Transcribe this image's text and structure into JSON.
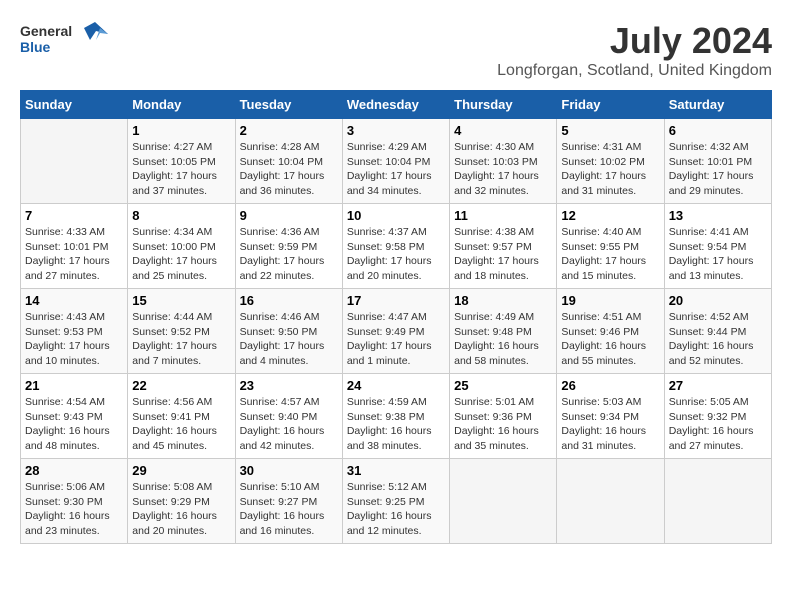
{
  "header": {
    "logo_general": "General",
    "logo_blue": "Blue",
    "month_year": "July 2024",
    "location": "Longforgan, Scotland, United Kingdom"
  },
  "days_of_week": [
    "Sunday",
    "Monday",
    "Tuesday",
    "Wednesday",
    "Thursday",
    "Friday",
    "Saturday"
  ],
  "weeks": [
    [
      {
        "num": "",
        "info": ""
      },
      {
        "num": "1",
        "info": "Sunrise: 4:27 AM\nSunset: 10:05 PM\nDaylight: 17 hours\nand 37 minutes."
      },
      {
        "num": "2",
        "info": "Sunrise: 4:28 AM\nSunset: 10:04 PM\nDaylight: 17 hours\nand 36 minutes."
      },
      {
        "num": "3",
        "info": "Sunrise: 4:29 AM\nSunset: 10:04 PM\nDaylight: 17 hours\nand 34 minutes."
      },
      {
        "num": "4",
        "info": "Sunrise: 4:30 AM\nSunset: 10:03 PM\nDaylight: 17 hours\nand 32 minutes."
      },
      {
        "num": "5",
        "info": "Sunrise: 4:31 AM\nSunset: 10:02 PM\nDaylight: 17 hours\nand 31 minutes."
      },
      {
        "num": "6",
        "info": "Sunrise: 4:32 AM\nSunset: 10:01 PM\nDaylight: 17 hours\nand 29 minutes."
      }
    ],
    [
      {
        "num": "7",
        "info": "Sunrise: 4:33 AM\nSunset: 10:01 PM\nDaylight: 17 hours\nand 27 minutes."
      },
      {
        "num": "8",
        "info": "Sunrise: 4:34 AM\nSunset: 10:00 PM\nDaylight: 17 hours\nand 25 minutes."
      },
      {
        "num": "9",
        "info": "Sunrise: 4:36 AM\nSunset: 9:59 PM\nDaylight: 17 hours\nand 22 minutes."
      },
      {
        "num": "10",
        "info": "Sunrise: 4:37 AM\nSunset: 9:58 PM\nDaylight: 17 hours\nand 20 minutes."
      },
      {
        "num": "11",
        "info": "Sunrise: 4:38 AM\nSunset: 9:57 PM\nDaylight: 17 hours\nand 18 minutes."
      },
      {
        "num": "12",
        "info": "Sunrise: 4:40 AM\nSunset: 9:55 PM\nDaylight: 17 hours\nand 15 minutes."
      },
      {
        "num": "13",
        "info": "Sunrise: 4:41 AM\nSunset: 9:54 PM\nDaylight: 17 hours\nand 13 minutes."
      }
    ],
    [
      {
        "num": "14",
        "info": "Sunrise: 4:43 AM\nSunset: 9:53 PM\nDaylight: 17 hours\nand 10 minutes."
      },
      {
        "num": "15",
        "info": "Sunrise: 4:44 AM\nSunset: 9:52 PM\nDaylight: 17 hours\nand 7 minutes."
      },
      {
        "num": "16",
        "info": "Sunrise: 4:46 AM\nSunset: 9:50 PM\nDaylight: 17 hours\nand 4 minutes."
      },
      {
        "num": "17",
        "info": "Sunrise: 4:47 AM\nSunset: 9:49 PM\nDaylight: 17 hours\nand 1 minute."
      },
      {
        "num": "18",
        "info": "Sunrise: 4:49 AM\nSunset: 9:48 PM\nDaylight: 16 hours\nand 58 minutes."
      },
      {
        "num": "19",
        "info": "Sunrise: 4:51 AM\nSunset: 9:46 PM\nDaylight: 16 hours\nand 55 minutes."
      },
      {
        "num": "20",
        "info": "Sunrise: 4:52 AM\nSunset: 9:44 PM\nDaylight: 16 hours\nand 52 minutes."
      }
    ],
    [
      {
        "num": "21",
        "info": "Sunrise: 4:54 AM\nSunset: 9:43 PM\nDaylight: 16 hours\nand 48 minutes."
      },
      {
        "num": "22",
        "info": "Sunrise: 4:56 AM\nSunset: 9:41 PM\nDaylight: 16 hours\nand 45 minutes."
      },
      {
        "num": "23",
        "info": "Sunrise: 4:57 AM\nSunset: 9:40 PM\nDaylight: 16 hours\nand 42 minutes."
      },
      {
        "num": "24",
        "info": "Sunrise: 4:59 AM\nSunset: 9:38 PM\nDaylight: 16 hours\nand 38 minutes."
      },
      {
        "num": "25",
        "info": "Sunrise: 5:01 AM\nSunset: 9:36 PM\nDaylight: 16 hours\nand 35 minutes."
      },
      {
        "num": "26",
        "info": "Sunrise: 5:03 AM\nSunset: 9:34 PM\nDaylight: 16 hours\nand 31 minutes."
      },
      {
        "num": "27",
        "info": "Sunrise: 5:05 AM\nSunset: 9:32 PM\nDaylight: 16 hours\nand 27 minutes."
      }
    ],
    [
      {
        "num": "28",
        "info": "Sunrise: 5:06 AM\nSunset: 9:30 PM\nDaylight: 16 hours\nand 23 minutes."
      },
      {
        "num": "29",
        "info": "Sunrise: 5:08 AM\nSunset: 9:29 PM\nDaylight: 16 hours\nand 20 minutes."
      },
      {
        "num": "30",
        "info": "Sunrise: 5:10 AM\nSunset: 9:27 PM\nDaylight: 16 hours\nand 16 minutes."
      },
      {
        "num": "31",
        "info": "Sunrise: 5:12 AM\nSunset: 9:25 PM\nDaylight: 16 hours\nand 12 minutes."
      },
      {
        "num": "",
        "info": ""
      },
      {
        "num": "",
        "info": ""
      },
      {
        "num": "",
        "info": ""
      }
    ]
  ]
}
